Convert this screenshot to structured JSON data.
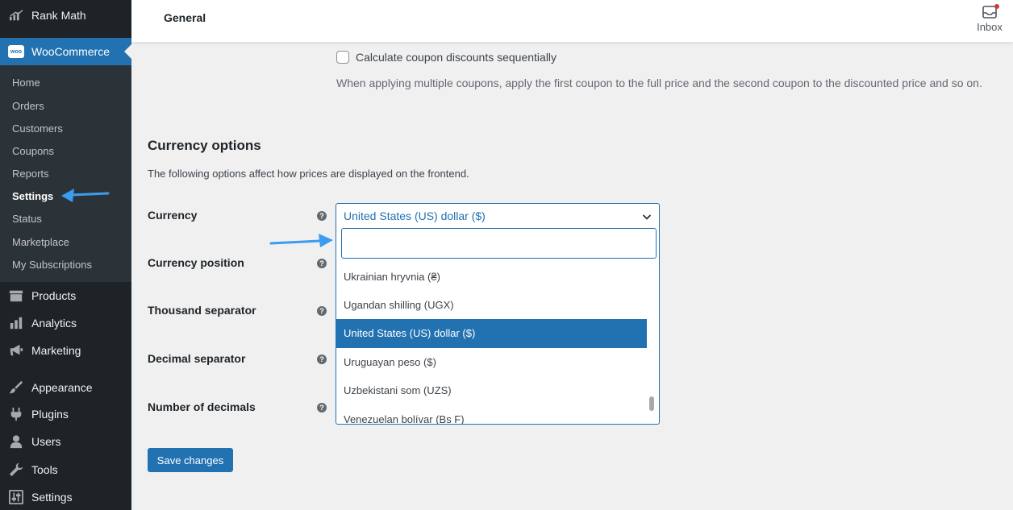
{
  "sidebar": {
    "rank_math": "Rank Math",
    "woocommerce": "WooCommerce",
    "woo_badge": "woo",
    "submenu": [
      "Home",
      "Orders",
      "Customers",
      "Coupons",
      "Reports",
      "Settings",
      "Status",
      "Marketplace",
      "My Subscriptions"
    ],
    "menu": [
      "Products",
      "Analytics",
      "Marketing",
      "Appearance",
      "Plugins",
      "Users",
      "Tools",
      "Settings"
    ]
  },
  "header": {
    "title": "General",
    "inbox": "Inbox"
  },
  "coupons": {
    "checkbox_label": "Calculate coupon discounts sequentially",
    "description": "When applying multiple coupons, apply the first coupon to the full price and the second coupon to the discounted price and so on."
  },
  "currency_section": {
    "title": "Currency options",
    "description": "The following options affect how prices are displayed on the frontend.",
    "labels": {
      "currency": "Currency",
      "position": "Currency position",
      "thousand": "Thousand separator",
      "decimal": "Decimal separator",
      "decimals": "Number of decimals"
    },
    "help": "?"
  },
  "currency_select": {
    "value": "United States (US) dollar ($)",
    "search_value": "",
    "options": [
      "Ukrainian hryvnia (₴)",
      "Ugandan shilling (UGX)",
      "United States (US) dollar ($)",
      "Uruguayan peso ($)",
      "Uzbekistani som (UZS)",
      "Venezuelan bolívar (Bs F)"
    ],
    "selected_index": 2
  },
  "save_label": "Save changes",
  "colors": {
    "accent": "#2271b1",
    "sidebar_bg": "#1d2327",
    "submenu_bg": "#2c3338",
    "annotation_arrow": "#3b9cf0"
  }
}
